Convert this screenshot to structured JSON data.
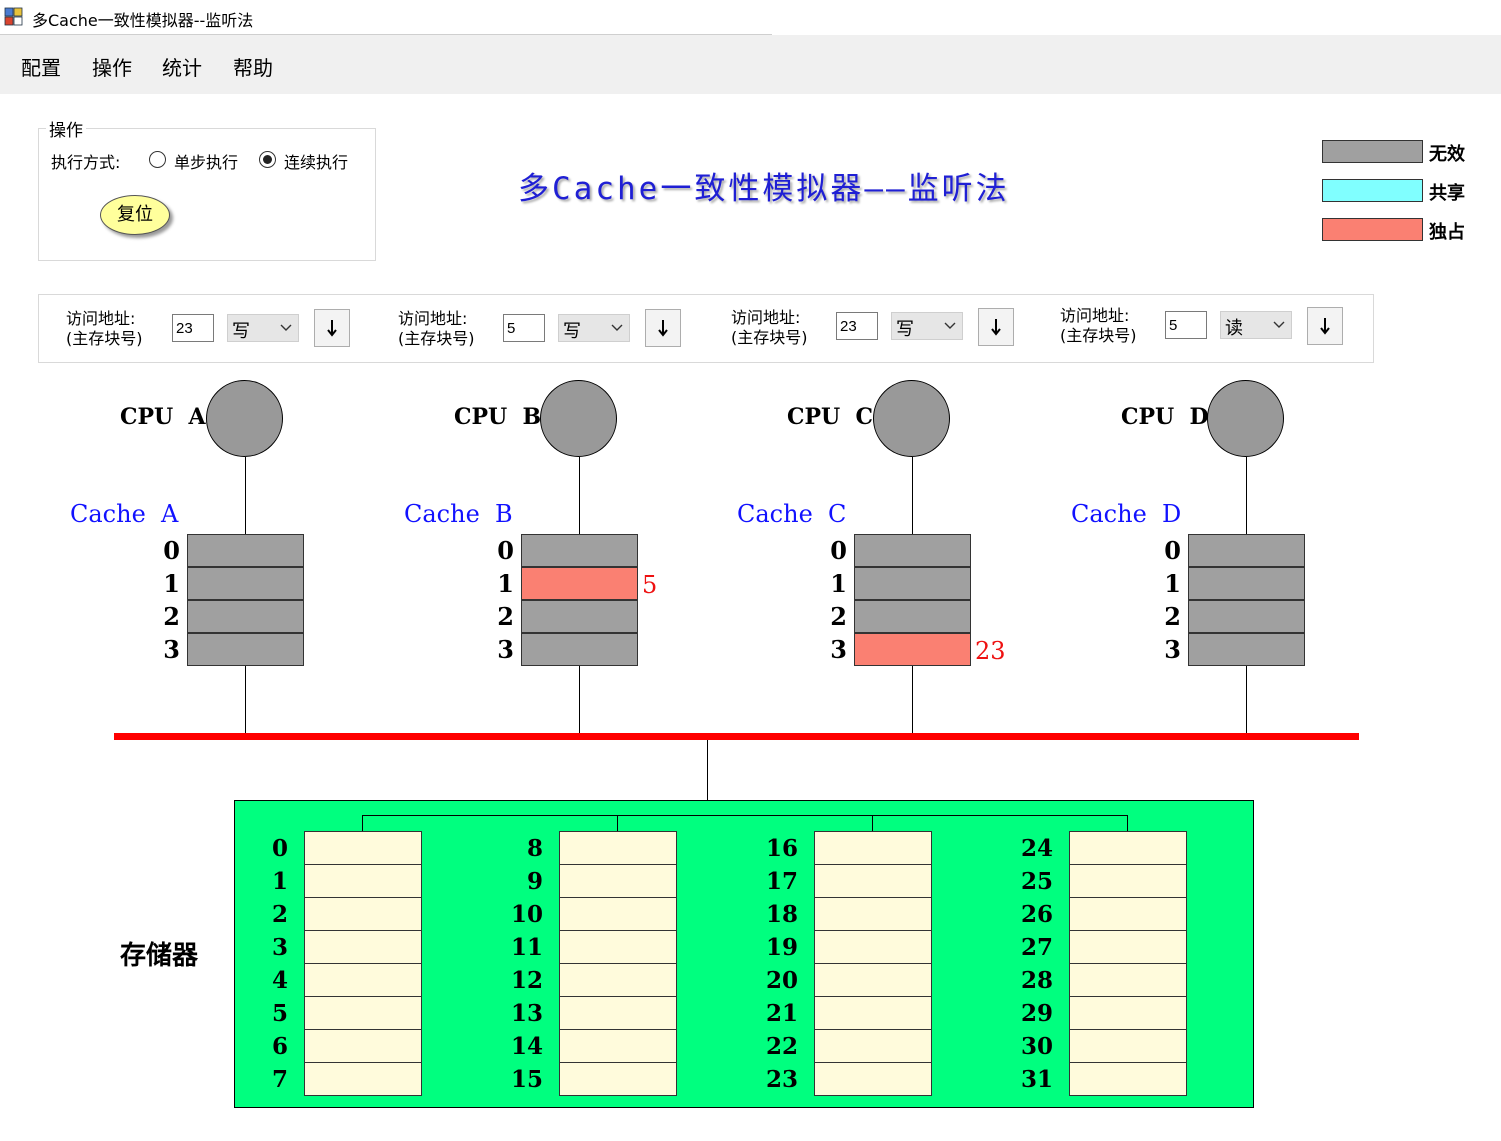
{
  "window": {
    "title": "多Cache一致性模拟器--监听法"
  },
  "menu": [
    "配置",
    "操作",
    "统计",
    "帮助"
  ],
  "operation": {
    "legend": "操作",
    "mode_label": "执行方式:",
    "options": [
      {
        "label": "单步执行",
        "selected": false
      },
      {
        "label": "连续执行",
        "selected": true
      }
    ],
    "reset_label": "复位"
  },
  "main_title": "多Cache一致性模拟器——监听法",
  "legend": [
    {
      "label": "无效",
      "color": "#a0a0a0"
    },
    {
      "label": "共享",
      "color": "#80ffff"
    },
    {
      "label": "独占",
      "color": "#fa8072"
    }
  ],
  "access": [
    {
      "label_line1": "访问地址:",
      "label_line2": "(主存块号)",
      "address": "23",
      "op": "写"
    },
    {
      "label_line1": "访问地址:",
      "label_line2": "(主存块号)",
      "address": "5",
      "op": "写"
    },
    {
      "label_line1": "访问地址:",
      "label_line2": "(主存块号)",
      "address": "23",
      "op": "写"
    },
    {
      "label_line1": "访问地址:",
      "label_line2": "(主存块号)",
      "address": "5",
      "op": "读"
    }
  ],
  "cpus": [
    {
      "label": "CPU A",
      "cache_label": "Cache A",
      "lines": [
        {
          "num": "0",
          "state": "invalid",
          "block": ""
        },
        {
          "num": "1",
          "state": "invalid",
          "block": ""
        },
        {
          "num": "2",
          "state": "invalid",
          "block": ""
        },
        {
          "num": "3",
          "state": "invalid",
          "block": ""
        }
      ]
    },
    {
      "label": "CPU B",
      "cache_label": "Cache B",
      "lines": [
        {
          "num": "0",
          "state": "invalid",
          "block": ""
        },
        {
          "num": "1",
          "state": "exclusive",
          "block": "5"
        },
        {
          "num": "2",
          "state": "invalid",
          "block": ""
        },
        {
          "num": "3",
          "state": "invalid",
          "block": ""
        }
      ]
    },
    {
      "label": "CPU C",
      "cache_label": "Cache C",
      "lines": [
        {
          "num": "0",
          "state": "invalid",
          "block": ""
        },
        {
          "num": "1",
          "state": "invalid",
          "block": ""
        },
        {
          "num": "2",
          "state": "invalid",
          "block": ""
        },
        {
          "num": "3",
          "state": "exclusive",
          "block": "23"
        }
      ]
    },
    {
      "label": "CPU D",
      "cache_label": "Cache D",
      "lines": [
        {
          "num": "0",
          "state": "invalid",
          "block": ""
        },
        {
          "num": "1",
          "state": "invalid",
          "block": ""
        },
        {
          "num": "2",
          "state": "invalid",
          "block": ""
        },
        {
          "num": "3",
          "state": "invalid",
          "block": ""
        }
      ]
    }
  ],
  "memory": {
    "label": "存储器",
    "blocks": [
      "0",
      "1",
      "2",
      "3",
      "4",
      "5",
      "6",
      "7",
      "8",
      "9",
      "10",
      "11",
      "12",
      "13",
      "14",
      "15",
      "16",
      "17",
      "18",
      "19",
      "20",
      "21",
      "22",
      "23",
      "24",
      "25",
      "26",
      "27",
      "28",
      "29",
      "30",
      "31"
    ]
  }
}
